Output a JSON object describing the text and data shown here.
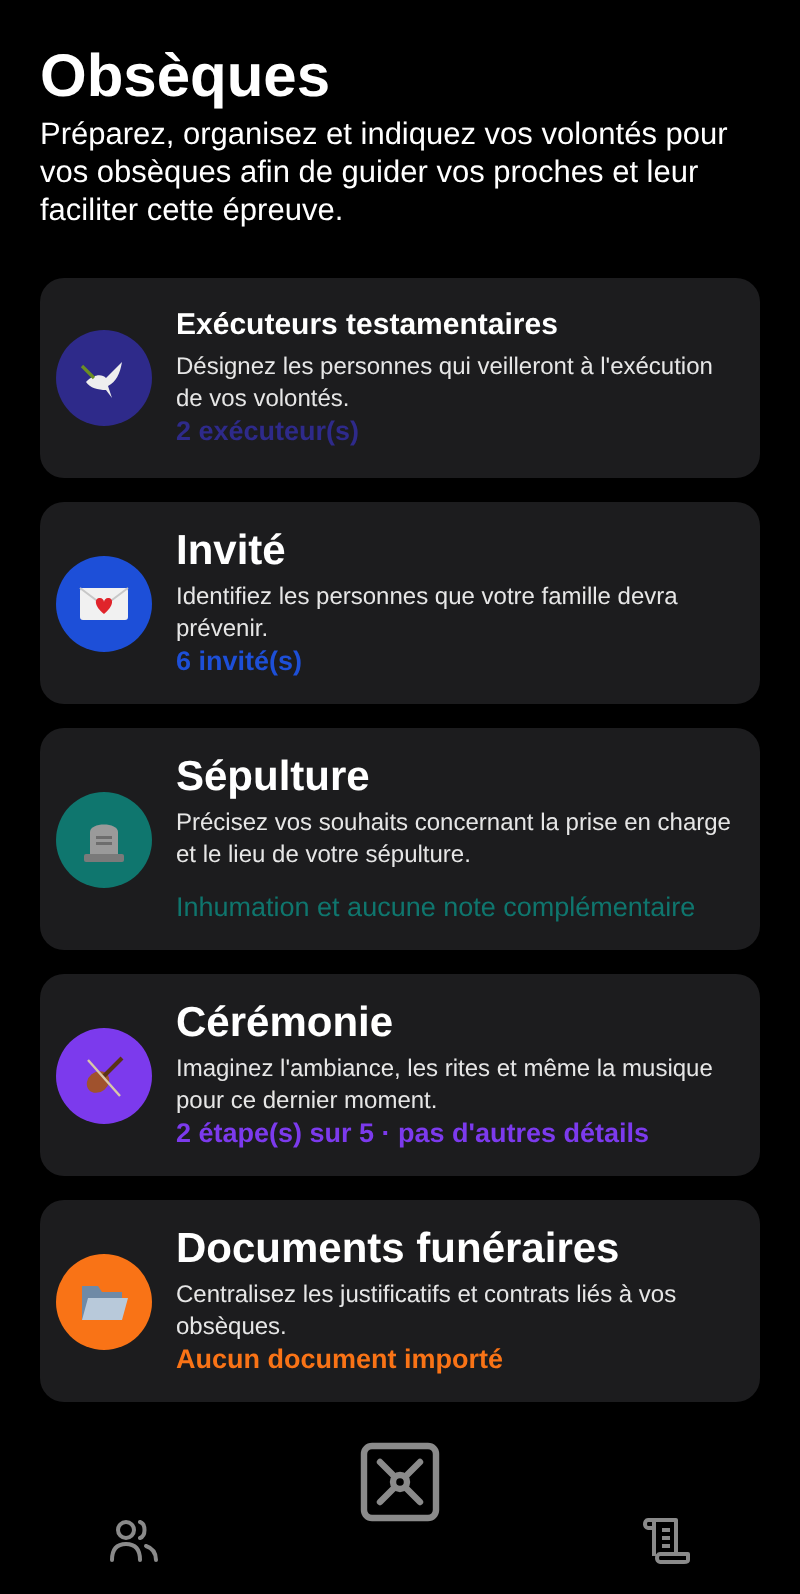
{
  "title": "Obsèques",
  "intro": "Préparez, organisez et indiquez vos volontés pour vos obsèques afin de guider vos proches et leur faciliter cette épreuve.",
  "cards": [
    {
      "kind": "compact",
      "title": "Exécuteurs testamentaires",
      "description": "Désignez les personnes qui veilleront à l'exécution de vos volontés.",
      "status": "2 exécuteur(s)",
      "color": "#2e2a8a"
    },
    {
      "kind": "regular",
      "title": "Invité",
      "description": "Identifiez les personnes que votre famille devra prévenir.",
      "status": "6 invité(s)",
      "color": "#1d4fd8"
    },
    {
      "kind": "muted",
      "title": "Sépulture",
      "description": "Précisez vos souhaits concernant la prise en charge et le lieu de votre sépulture.",
      "status": "Inhumation et aucune note complémentaire",
      "color": "#0f766e"
    },
    {
      "kind": "regular",
      "title": "Cérémonie",
      "description": "Imaginez l'ambiance, les rites et même la musique pour ce dernier moment.",
      "status": "2 étape(s) sur 5 · pas d'autres détails",
      "color": "#7c3aed"
    },
    {
      "kind": "regular",
      "title": "Documents funéraires",
      "description": "Centralisez les justificatifs et contrats liés à vos obsèques.",
      "status": "Aucun document importé",
      "color": "#f97316"
    }
  ]
}
